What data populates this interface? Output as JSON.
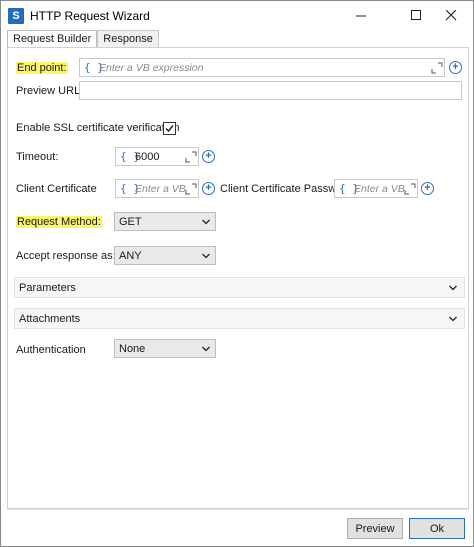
{
  "window": {
    "icon_letter": "S",
    "title": "HTTP Request Wizard"
  },
  "tabs": [
    {
      "label": "Request Builder",
      "active": true
    },
    {
      "label": "Response",
      "active": false
    }
  ],
  "form": {
    "end_point": {
      "label": "End point:",
      "placeholder": "Enter a VB expression",
      "brace": "{ }"
    },
    "preview_url": {
      "label": "Preview URL:",
      "value": ""
    },
    "ssl": {
      "label": "Enable SSL certificate verification",
      "checked": true
    },
    "timeout": {
      "label": "Timeout:",
      "value": "6000",
      "brace": "{ }"
    },
    "client_certificate": {
      "label": "Client Certificate",
      "placeholder": "Enter a VB",
      "brace": "{ }"
    },
    "client_certificate_password": {
      "label": "Client Certificate Password",
      "placeholder": "Enter a VB",
      "brace": "{ }"
    },
    "request_method": {
      "label": "Request Method:",
      "value": "GET"
    },
    "accept_response": {
      "label": "Accept response as:",
      "value": "ANY"
    },
    "authentication": {
      "label": "Authentication",
      "value": "None"
    }
  },
  "sections": {
    "parameters": "Parameters",
    "attachments": "Attachments"
  },
  "footer": {
    "preview": "Preview",
    "ok": "Ok"
  },
  "colors": {
    "highlight": "#f7f56a",
    "accent": "#2f6fb6",
    "app_icon": "#1f6fb8"
  }
}
